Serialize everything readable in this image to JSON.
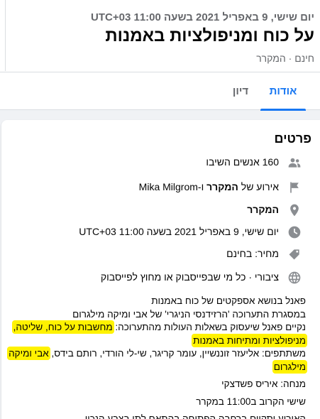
{
  "header": {
    "date_line": "יום שישי, 9 באפריל 2021 בשעה 11:00 UTC+03",
    "title": "על כוח ומניפולציות באמנות",
    "subtitle": "חינם · המקרר"
  },
  "tabs": [
    {
      "label": "אודות",
      "active": true
    },
    {
      "label": "דיון",
      "active": false
    }
  ],
  "details": {
    "title": "פרטים",
    "attendees": "160 אנשים השיבו",
    "host_prefix": "אירוע של ",
    "host_bold": "המקרר",
    "host_suffix": " ו-Mika Milgrom",
    "location": "המקרר",
    "datetime": "יום שישי, 9 באפריל 2021 בשעה 11:00 UTC+03",
    "price": "מחיר: בחינם",
    "privacy": "ציבורי · כל מי שבפייסבוק או מחוץ לפייסבוק"
  },
  "description": {
    "line1": "פאנל בנושא אספקטים של כוח באמנות",
    "line2": "במסגרת התערוכה 'הרזידנסי הניגרי' של אבי ומיקה מילגרום",
    "line3_plain": "נקיים פאנל שיעסוק בשאלות העולות מהתערוכה: ",
    "line3_hl": "מחשבות על כוח, שליטה,",
    "line4_hl": "מניפולציות ומתיחות באמנות",
    "line5_plain": "משתתפים: אליעזר זוננשיין, עומר קריגר, שי-לי הורדי, רותם בידס, ",
    "line5_hl": "אבי ומיקה",
    "line6_hl": "מילגרום",
    "line7": "מנחה: איריס פשדצקי",
    "line8": "שישי הקרוב ב11:00 במקרר",
    "line9": "האירוע יתקיים ברחבה הפתוחה בהתאם לתו בצבע הנכון"
  },
  "icons": {
    "attendees": "people-icon",
    "host": "flag-icon",
    "location": "location-pin-icon",
    "time": "clock-icon",
    "price": "tag-icon",
    "privacy": "globe-icon"
  },
  "colors": {
    "accent": "#1877f2",
    "highlight": "#fff200",
    "icon_gray": "#8a8d91"
  }
}
